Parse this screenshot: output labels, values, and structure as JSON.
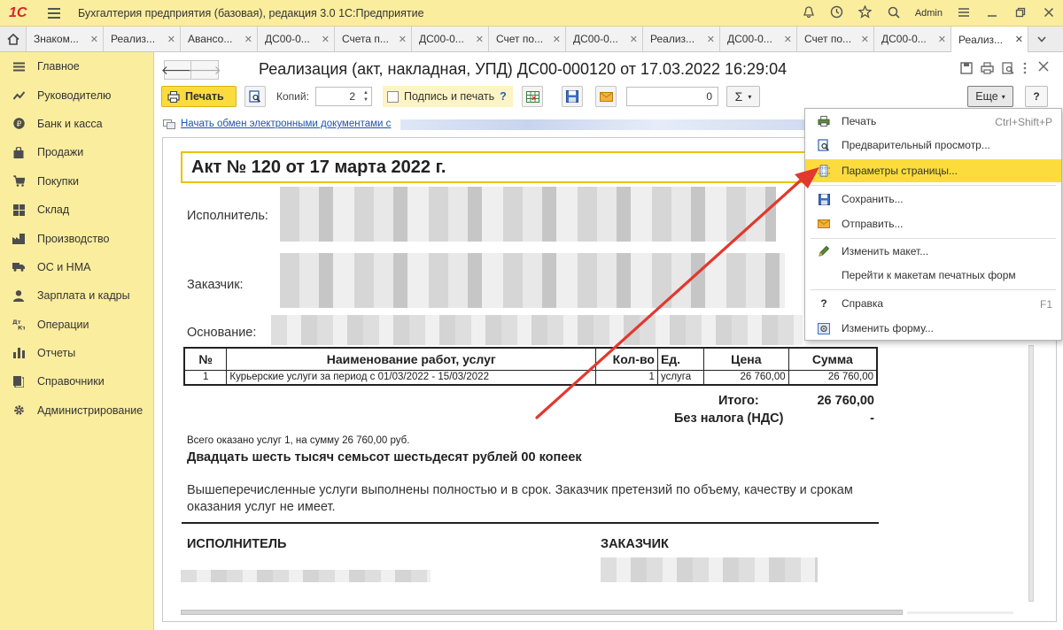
{
  "app": {
    "logo": "1С",
    "title": "Бухгалтерия предприятия (базовая), редакция 3.0 1С:Предприятие",
    "user": "Admin"
  },
  "tabs": [
    {
      "label": "Знаком..."
    },
    {
      "label": "Реализ..."
    },
    {
      "label": "Авансо..."
    },
    {
      "label": "ДС00-0..."
    },
    {
      "label": "Счета п..."
    },
    {
      "label": "ДС00-0..."
    },
    {
      "label": "Счет по..."
    },
    {
      "label": "ДС00-0..."
    },
    {
      "label": "Реализ..."
    },
    {
      "label": "ДС00-0..."
    },
    {
      "label": "Счет по..."
    },
    {
      "label": "ДС00-0..."
    },
    {
      "label": "Реализ...",
      "active": true
    }
  ],
  "sidebar": {
    "items": [
      {
        "label": "Главное",
        "icon": "menu-icon"
      },
      {
        "label": "Руководителю",
        "icon": "chart-icon"
      },
      {
        "label": "Банк и касса",
        "icon": "ruble-icon"
      },
      {
        "label": "Продажи",
        "icon": "bag-icon"
      },
      {
        "label": "Покупки",
        "icon": "cart-icon"
      },
      {
        "label": "Склад",
        "icon": "grid-icon"
      },
      {
        "label": "Производство",
        "icon": "factory-icon"
      },
      {
        "label": "ОС и НМА",
        "icon": "truck-icon"
      },
      {
        "label": "Зарплата и кадры",
        "icon": "person-icon"
      },
      {
        "label": "Операции",
        "icon": "dt-kt-icon"
      },
      {
        "label": "Отчеты",
        "icon": "bar-chart-icon"
      },
      {
        "label": "Справочники",
        "icon": "book-icon"
      },
      {
        "label": "Администрирование",
        "icon": "gear-icon"
      }
    ]
  },
  "doc": {
    "title": "Реализация (акт, накладная, УПД) ДС00-000120 от 17.03.2022 16:29:04"
  },
  "toolbar": {
    "print_label": "Печать",
    "copies_label": "Копий:",
    "copies_value": "2",
    "sign_print_label": "Подпись и печать",
    "help_mark": "?",
    "sum_value": "0",
    "sigma": "Σ",
    "more_label": "Еще",
    "help_label": "?"
  },
  "exchange_link": "Начать обмен электронными документами с",
  "sheet": {
    "act_title": "Акт № 120 от 17 марта 2022 г.",
    "executor_label": "Исполнитель:",
    "customer_label": "Заказчик:",
    "basis_label": "Основание:",
    "table": {
      "headers": [
        "№",
        "Наименование работ, услуг",
        "Кол-во",
        "Ед.",
        "Цена",
        "Сумма"
      ],
      "rows": [
        [
          "1",
          "Курьерские услуги за период с 01/03/2022 - 15/03/2022",
          "1",
          "услуга",
          "26 760,00",
          "26 760,00"
        ]
      ]
    },
    "total_label": "Итого:",
    "total_value": "26 760,00",
    "vat_label": "Без налога (НДС)",
    "vat_value": "-",
    "summary_line": "Всего оказано услуг 1, на сумму 26 760,00 руб.",
    "amount_words": "Двадцать шесть тысяч семьсот шестьдесят рублей 00 копеек",
    "note_line1": "Вышеперечисленные услуги выполнены полностью и в срок. Заказчик претензий по объему, качеству и срокам",
    "note_line2": "оказания услуг не имеет.",
    "executor_sign": "ИСПОЛНИТЕЛЬ",
    "customer_sign": "ЗАКАЗЧИК"
  },
  "menu": {
    "items": [
      {
        "label": "Печать",
        "shortcut": "Ctrl+Shift+P",
        "icon": "printer-icon"
      },
      {
        "label": "Предварительный просмотр...",
        "shortcut": "",
        "icon": "preview-icon"
      },
      {
        "label": "Параметры страницы...",
        "shortcut": "",
        "icon": "page-settings-icon",
        "highlighted": true
      },
      {
        "label": "Сохранить...",
        "shortcut": "",
        "icon": "save-icon"
      },
      {
        "label": "Отправить...",
        "shortcut": "",
        "icon": "envelope-icon"
      },
      {
        "label": "Изменить макет...",
        "shortcut": "",
        "icon": "edit-icon"
      },
      {
        "label": "Перейти к макетам печатных форм",
        "shortcut": "",
        "icon": ""
      },
      {
        "label": "Справка",
        "shortcut": "F1",
        "icon": "help-icon"
      },
      {
        "label": "Изменить форму...",
        "shortcut": "",
        "icon": "form-icon"
      }
    ]
  },
  "colors": {
    "sidebar": "#fbed9e",
    "accent_yellow": "#fcdc3d",
    "arrow_red": "#e2382e",
    "link_blue": "#1b55b0",
    "logo_red": "#d9242b"
  }
}
